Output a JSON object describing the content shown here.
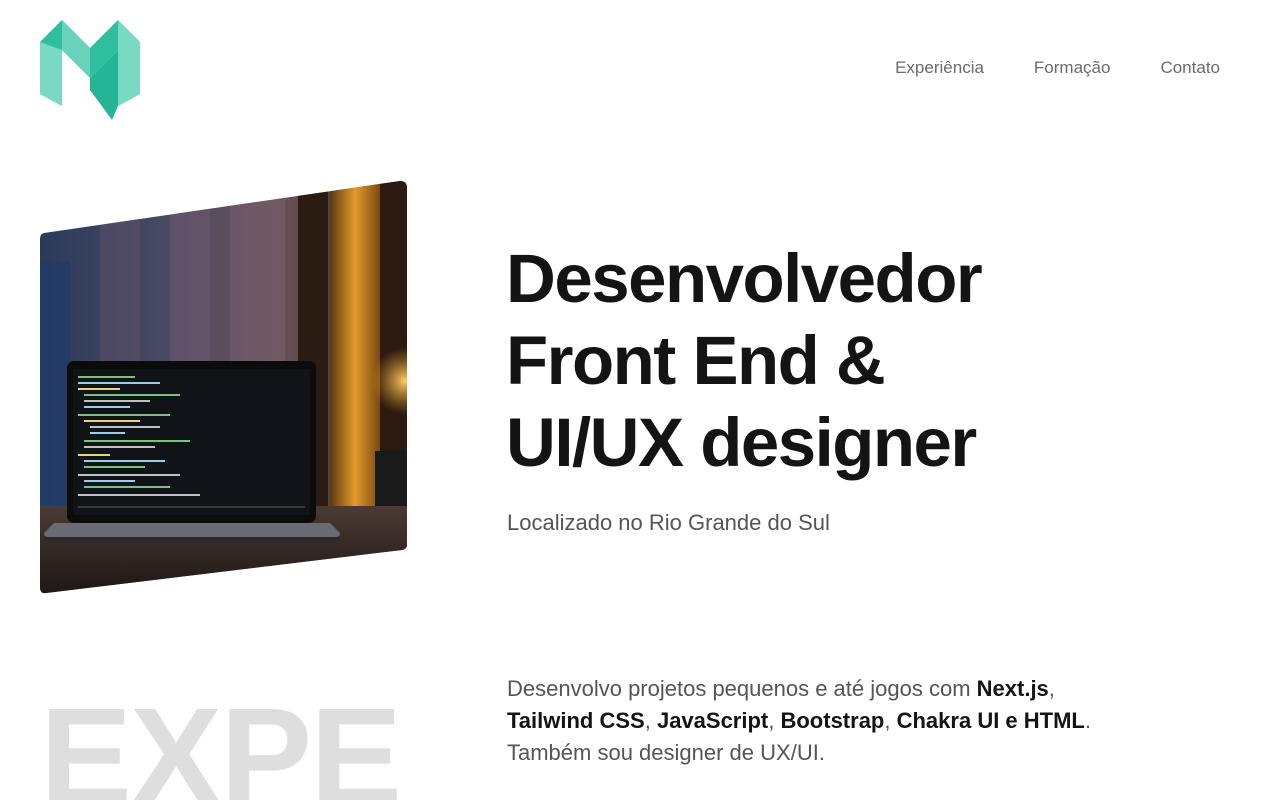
{
  "header": {
    "logo": "m-logo",
    "nav": [
      {
        "label": "Experiência"
      },
      {
        "label": "Formação"
      },
      {
        "label": "Contato"
      }
    ]
  },
  "hero": {
    "image": "laptop-code-photo",
    "title_lines": [
      "Desenvolvedor",
      "Front End &",
      "UI/UX designer"
    ],
    "subtitle": "Localizado no Rio Grande do Sul"
  },
  "bio": {
    "intro": "Desenvolvo projetos pequenos e até jogos com ",
    "tech": [
      "Next.js",
      "Tailwind CSS",
      "JavaScript",
      "Bootstrap",
      "Chakra UI e HTML"
    ],
    "sep": ", ",
    "outro": ". Também sou designer de UX/UI."
  },
  "section": {
    "watermark": "EXPE"
  },
  "colors": {
    "logo_primary": "#2ebf9f",
    "logo_light": "#72d6bf",
    "title": "#141414",
    "muted": "#555555",
    "nav": "#6b6b6b",
    "watermark": "#dedede"
  }
}
